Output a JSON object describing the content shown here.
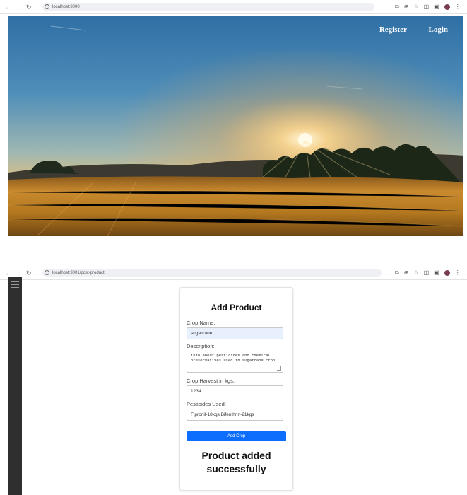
{
  "screen1": {
    "browser": {
      "back": "←",
      "forward": "→",
      "reload": "↻",
      "url": "localhost:3000",
      "icons": [
        "cast-icon",
        "zoom-icon",
        "star-icon",
        "extension-icon",
        "sidepanel-icon",
        "profile-avatar",
        "menu-icon"
      ]
    },
    "nav": {
      "register": "Register",
      "login": "Login"
    }
  },
  "screen2": {
    "browser": {
      "back": "←",
      "forward": "→",
      "reload": "↻",
      "url": "localhost:3001/post-product"
    },
    "form": {
      "title": "Add Product",
      "crop_name_label": "Crop Name:",
      "crop_name_value": "sugarcane",
      "description_label": "Description:",
      "description_value": "info about pesticides and chemical preservatives used in sugarcane crop",
      "harvest_label": "Crop Harvest in kgs:",
      "harvest_value": "1234",
      "pesticides_label": "Pesticides Used:",
      "pesticides_value": "Fipronil-18kgs,Bifenthrin-21kgs",
      "submit_label": "Add Crop",
      "success_message": "Product added successfully"
    }
  },
  "colors": {
    "accent": "#0d6efd",
    "sidebar": "#2f2f2f",
    "autofill": "#e8f0fd"
  }
}
